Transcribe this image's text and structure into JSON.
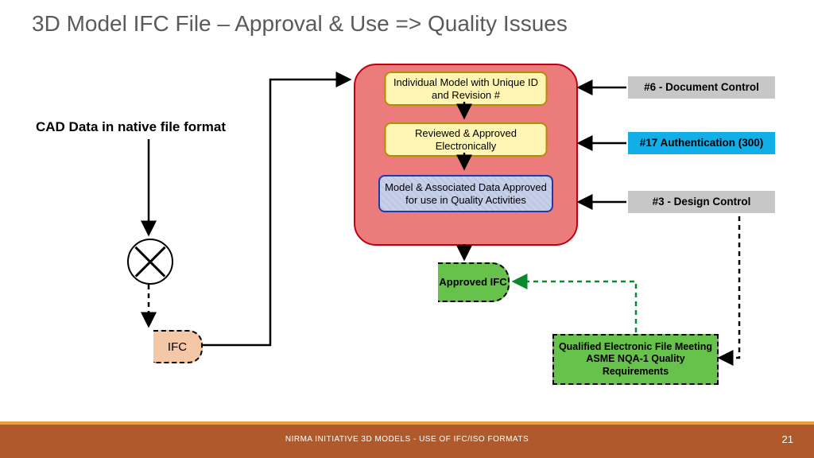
{
  "title": "3D Model IFC File – Approval & Use => Quality Issues",
  "cad_label": "CAD Data in native file format",
  "approval": {
    "box1": "Individual Model with Unique ID and Revision #",
    "box2": "Reviewed & Approved Electronically",
    "box3": "Model & Associated Data Approved for use in Quality Activities"
  },
  "tags": {
    "doc": "#6 - Document Control",
    "auth": "#17 Authentication (300)",
    "des": "#3 - Design Control"
  },
  "approved_ifc": "Approved IFC",
  "qualified": "Qualified Electronic File Meeting ASME NQA-1 Quality Requirements",
  "ifc_box": "IFC",
  "footer": {
    "text": "NIRMA INITIATIVE  3D MODELS - USE OF IFC/ISO FORMATS",
    "page": "21"
  }
}
